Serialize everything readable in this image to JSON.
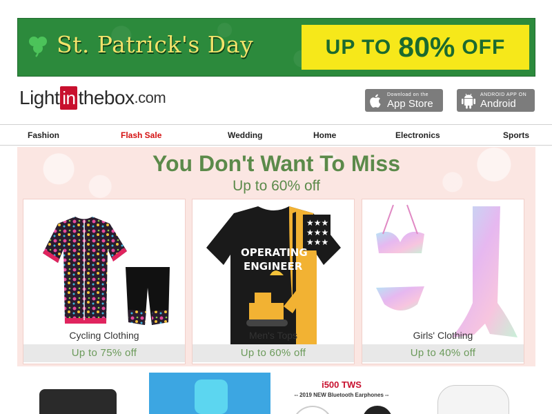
{
  "banner": {
    "title": "St. Patrick's Day",
    "offer_prefix": "UP TO",
    "offer_value": "80%",
    "offer_suffix": "OFF",
    "colors": {
      "background": "#2c8a3c",
      "offer_bg": "#f6e81a",
      "title": "#f3e26a"
    }
  },
  "logo": {
    "part1": "Light",
    "part2": "in",
    "part3": "thebox",
    "part4": ".com"
  },
  "apps": {
    "appstore": {
      "small": "Download on the",
      "large": "App Store",
      "icon": "apple-icon"
    },
    "android": {
      "small": "ANDROID APP ON",
      "large": "Android",
      "icon": "android-icon"
    }
  },
  "nav": {
    "items": [
      "Fashion",
      "Flash Sale",
      "Wedding",
      "Home",
      "Electronics",
      "Sports"
    ],
    "highlight_color": "#d40f0f"
  },
  "promo": {
    "heading": "You Don't Want To Miss",
    "subheading": "Up to 60% off",
    "cards": [
      {
        "label": "Cycling Clothing",
        "offer": "Up to 75% off"
      },
      {
        "label": "Men's Tops",
        "offer": "Up to 60% off",
        "shirt_text": "OPERATING ENGINEER"
      },
      {
        "label": "Girls' Clothing",
        "offer": "Up to 40% off"
      }
    ]
  },
  "strip": {
    "tws_title": "i500 TWS",
    "tws_sub": "-- 2019 NEW Bluetooth Earphones --"
  }
}
